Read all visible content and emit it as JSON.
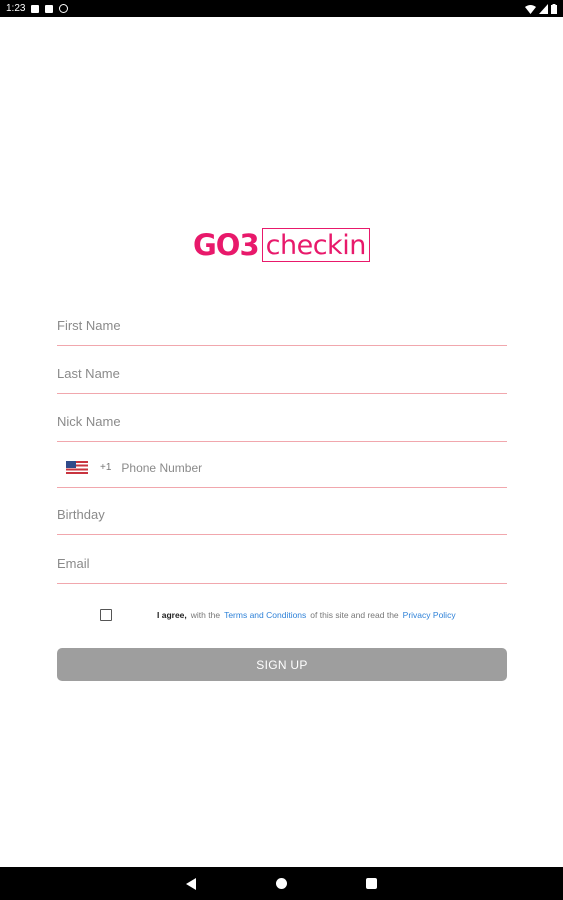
{
  "status_bar": {
    "time": "1:23",
    "icons": [
      "notification-icon",
      "sim-icon",
      "sync-icon",
      "wifi-icon",
      "signal-icon",
      "battery-icon"
    ]
  },
  "logo": {
    "part1": "GO3",
    "part2": "checkin",
    "color": "#e8196b"
  },
  "form": {
    "first_name": {
      "placeholder": "First Name"
    },
    "last_name": {
      "placeholder": "Last Name"
    },
    "nick_name": {
      "placeholder": "Nick Name"
    },
    "phone": {
      "country_flag": "us-flag-icon",
      "dial_code": "+1",
      "placeholder": "Phone Number"
    },
    "birthday": {
      "placeholder": "Birthday"
    },
    "email": {
      "placeholder": "Email"
    }
  },
  "agreement": {
    "checked": false,
    "bold_text": "I agree,",
    "text1": "with the",
    "terms_link": "Terms and Conditions",
    "text2": "of this site and read the",
    "privacy_link": "Privacy Policy"
  },
  "signup_button": {
    "label": "SIGN UP",
    "color": "#9e9e9e"
  },
  "nav_bar": {
    "icons": [
      "back-icon",
      "home-icon",
      "recent-apps-icon"
    ]
  },
  "colors": {
    "accent": "#e8196b",
    "underline": "#f1a7ad",
    "link": "#2f82d8"
  }
}
